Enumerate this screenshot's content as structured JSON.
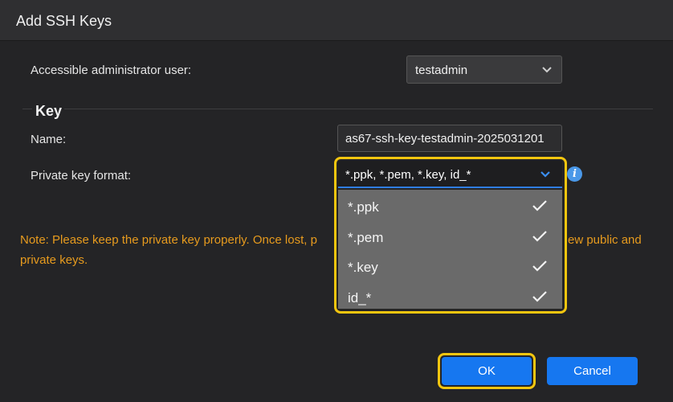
{
  "dialog": {
    "title": "Add SSH Keys"
  },
  "admin_user": {
    "label": "Accessible administrator user:",
    "value": "testadmin"
  },
  "key_section": {
    "title": "Key"
  },
  "name_field": {
    "label": "Name:",
    "value": "as67-ssh-key-testadmin-2025031201"
  },
  "private_key_format": {
    "label": "Private key format:",
    "value": "*.ppk, *.pem, *.key, id_*",
    "options": [
      {
        "label": "*.ppk",
        "checked": true
      },
      {
        "label": "*.pem",
        "checked": true
      },
      {
        "label": "*.key",
        "checked": true
      },
      {
        "label": "id_*",
        "checked": true
      }
    ]
  },
  "note": {
    "line1_start": "Note: Please keep the private key properly. Once lost, p",
    "line1_end": "ew public and",
    "line2": "private keys."
  },
  "buttons": {
    "ok": "OK",
    "cancel": "Cancel"
  },
  "colors": {
    "accent": "#1677f0",
    "highlight": "#f3c60f",
    "note": "#e79b1e"
  }
}
